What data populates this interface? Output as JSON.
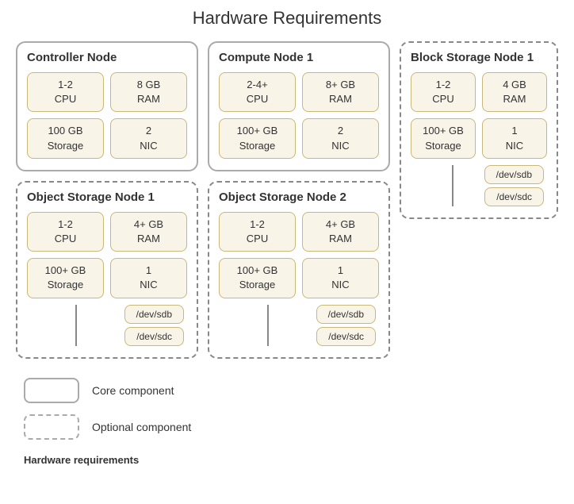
{
  "title": "Hardware Requirements",
  "nodes": {
    "controller": {
      "name": "Controller Node",
      "solid": true,
      "specs": [
        {
          "label": "1-2\nCPU"
        },
        {
          "label": "8 GB\nRAM"
        },
        {
          "label": "100 GB\nStorage"
        },
        {
          "label": "2\nNIC"
        }
      ],
      "devs": []
    },
    "compute": {
      "name": "Compute Node 1",
      "solid": true,
      "specs": [
        {
          "label": "2-4+\nCPU"
        },
        {
          "label": "8+ GB\nRAM"
        },
        {
          "label": "100+ GB\nStorage"
        },
        {
          "label": "2\nNIC"
        }
      ],
      "devs": []
    },
    "block": {
      "name": "Block Storage Node 1",
      "solid": false,
      "specs": [
        {
          "label": "1-2\nCPU"
        },
        {
          "label": "4 GB\nRAM"
        },
        {
          "label": "100+ GB\nStorage"
        },
        {
          "label": "1\nNIC"
        }
      ],
      "devs": [
        "/dev/sdb",
        "/dev/sdc"
      ]
    },
    "object1": {
      "name": "Object Storage Node 1",
      "solid": false,
      "specs": [
        {
          "label": "1-2\nCPU"
        },
        {
          "label": "4+ GB\nRAM"
        },
        {
          "label": "100+ GB\nStorage"
        },
        {
          "label": "1\nNIC"
        }
      ],
      "devs": [
        "/dev/sdb",
        "/dev/sdc"
      ]
    },
    "object2": {
      "name": "Object Storage Node 2",
      "solid": false,
      "specs": [
        {
          "label": "1-2\nCPU"
        },
        {
          "label": "4+ GB\nRAM"
        },
        {
          "label": "100+ GB\nStorage"
        },
        {
          "label": "1\nNIC"
        }
      ],
      "devs": [
        "/dev/sdb",
        "/dev/sdc"
      ]
    }
  },
  "legend": {
    "core_label": "Core component",
    "optional_label": "Optional component"
  },
  "footer": "Hardware requirements"
}
